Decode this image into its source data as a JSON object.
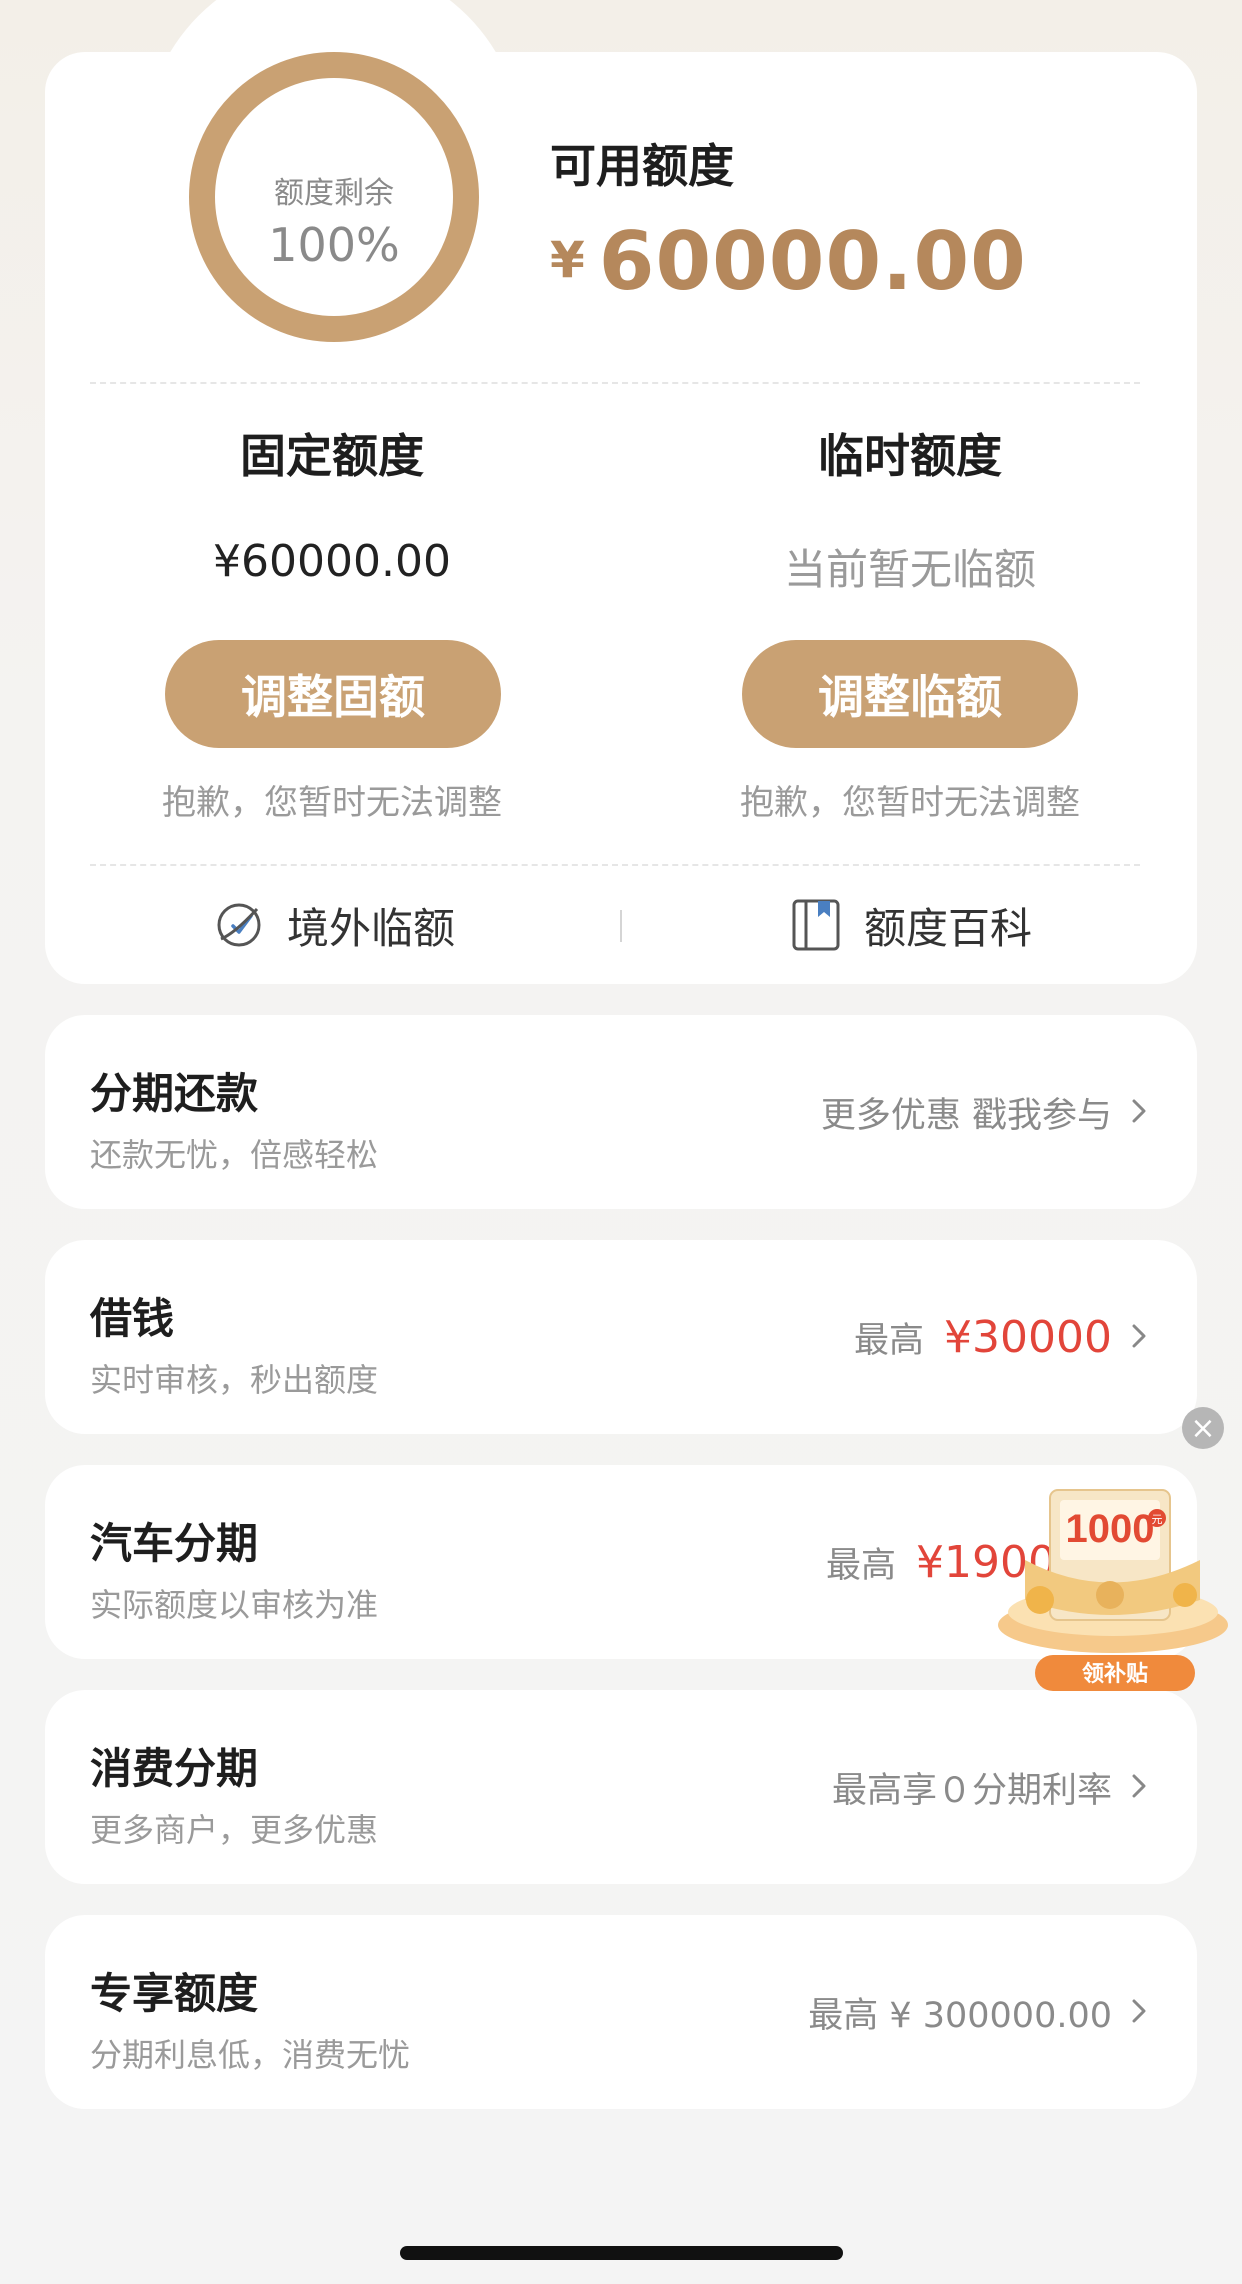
{
  "quota": {
    "ring_label": "额度剩余",
    "ring_percent": "100%",
    "ring_fraction": 1.0,
    "available_title": "可用额度",
    "available_currency": "¥",
    "available_amount": "60000.00",
    "fixed": {
      "title": "固定额度",
      "amount": "¥60000.00",
      "button": "调整固额",
      "note": "抱歉，您暂时无法调整"
    },
    "temporary": {
      "title": "临时额度",
      "amount": "当前暂无临额",
      "button": "调整临额",
      "note": "抱歉，您暂时无法调整"
    },
    "links": {
      "overseas": "境外临额",
      "encyclopedia": "额度百科"
    }
  },
  "rows": [
    {
      "title": "分期还款",
      "subtitle": "还款无忧，倍感轻松",
      "right_text": "更多优惠 戳我参与",
      "right_amount": ""
    },
    {
      "title": "借钱",
      "subtitle": "实时审核，秒出额度",
      "right_text": "最高",
      "right_amount": "¥30000"
    },
    {
      "title": "汽车分期",
      "subtitle": "实际额度以审核为准",
      "right_text": "最高",
      "right_amount": "¥190000"
    },
    {
      "title": "消费分期",
      "subtitle": "更多商户，更多优惠",
      "right_text": "最高享０分期利率",
      "right_amount": ""
    },
    {
      "title": "专享额度",
      "subtitle": "分期利息低，消费无忧",
      "right_text": "最高 ¥ 300000.00",
      "right_amount": ""
    }
  ],
  "promo": {
    "amount": "1000",
    "unit": "元",
    "button": "领补贴",
    "close": "×"
  },
  "colors": {
    "accent_gold": "#c9a173",
    "amount_gold": "#b5885c",
    "red": "#e2453a"
  }
}
